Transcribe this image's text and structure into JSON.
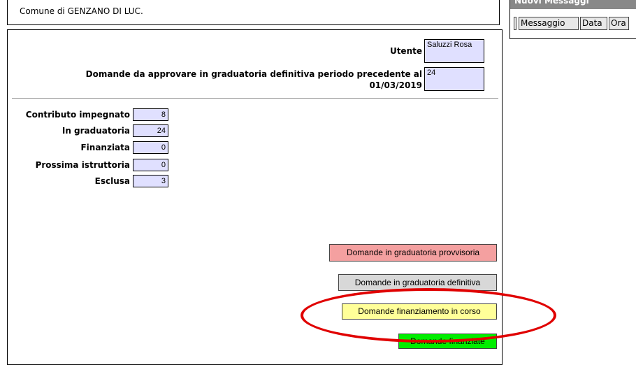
{
  "header": {
    "comune": "Comune di GENZANO DI LUC."
  },
  "messages": {
    "title": "Nuovi Messaggi",
    "columns": [
      "Messaggio",
      "Data",
      "Ora"
    ]
  },
  "form": {
    "utente_label": "Utente",
    "utente_value": "Saluzzi Rosa",
    "domande_label_line1": "Domande da approvare in graduatoria definitiva periodo precedente al",
    "domande_label_line2": "01/03/2019",
    "domande_value": "24"
  },
  "stats": [
    {
      "label": "Contributo impegnato",
      "value": "8"
    },
    {
      "label": "In graduatoria",
      "value": "24"
    },
    {
      "label": "Finanziata",
      "value": "0"
    },
    {
      "label": "Prossima istruttoria",
      "value": "0"
    },
    {
      "label": "Esclusa",
      "value": "3"
    }
  ],
  "buttons": {
    "provvisoria": {
      "label": "Domande in graduatoria provvisoria",
      "color": "#f4a0a0"
    },
    "definitiva": {
      "label": "Domande in graduatoria definitiva",
      "color": "#d8d8d8"
    },
    "in_corso": {
      "label": "Domande finanziamento in corso",
      "color": "#ffff99"
    },
    "finanziate": {
      "label": "Domande finanziate",
      "color": "#00ee00"
    }
  },
  "annotation": {
    "color": "#e00000"
  }
}
